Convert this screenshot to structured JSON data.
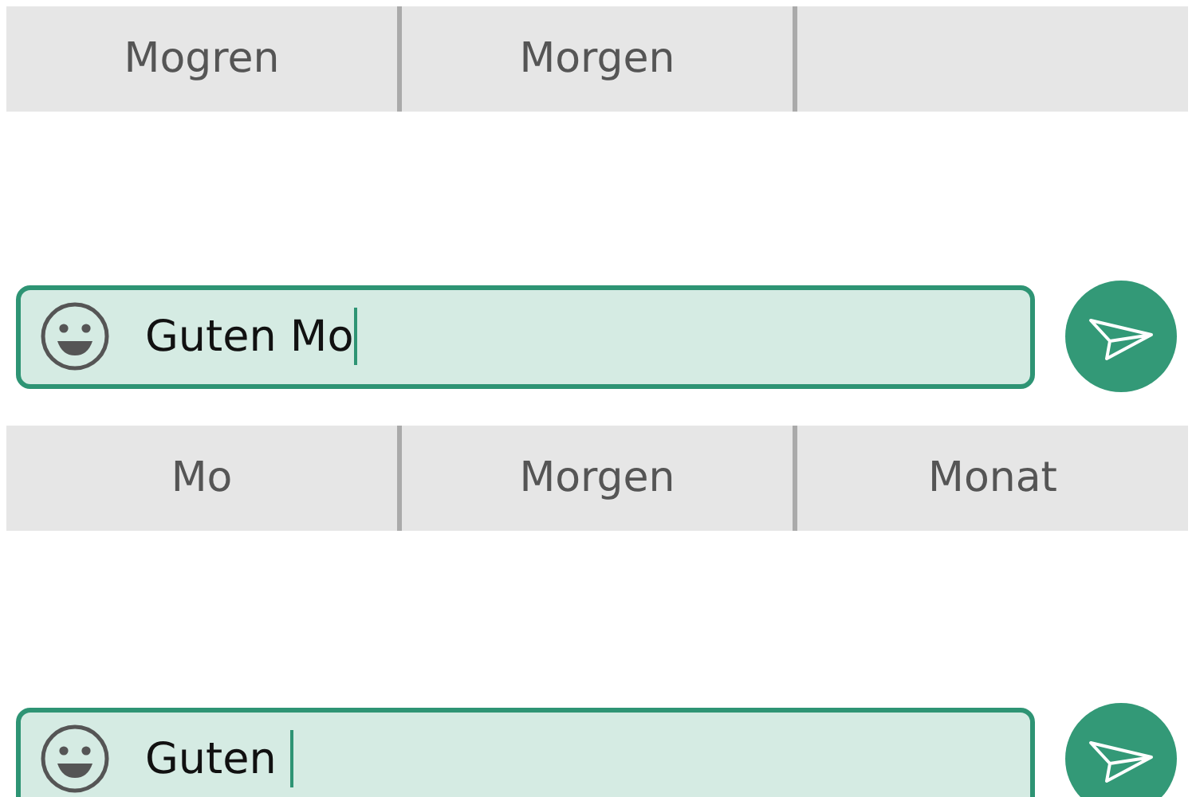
{
  "rows": [
    {
      "kind": "suggestions",
      "items": [
        {
          "label": "Mogren"
        },
        {
          "label": "Morgen"
        }
      ]
    },
    {
      "kind": "composer",
      "value": "Guten Mo"
    },
    {
      "kind": "suggestions",
      "items": [
        {
          "label": "Mo"
        },
        {
          "label": "Morgen"
        },
        {
          "label": "Monat"
        }
      ]
    },
    {
      "kind": "composer",
      "value": "Guten "
    }
  ]
}
